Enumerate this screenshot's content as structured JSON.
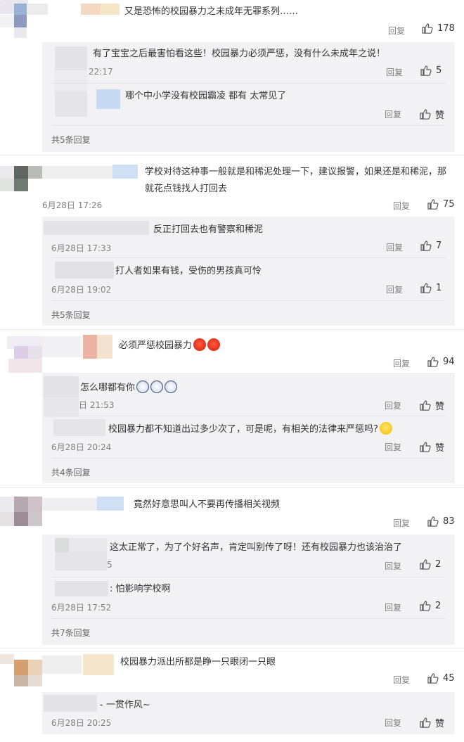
{
  "ui": {
    "reply_label": "回复",
    "like_label_zan": "赞"
  },
  "threads": [
    {
      "text": "又是恐怖的校园暴力之未成年无罪系列……",
      "likes": "178",
      "replies": [
        {
          "text": "有了宝宝之后最害怕看这些！校园暴力必须严惩，没有什么未成年之说！",
          "time": "22:17",
          "likes": "5"
        },
        {
          "text": "哪个中小学没有校园霸凌 都有 太常见了",
          "time": "",
          "likes": "赞"
        }
      ],
      "more": "共5条回复"
    },
    {
      "text": "学校对待这种事一般就是和稀泥处理一下，建议报警，如果还是和稀泥，那就花点钱找人打回去",
      "time": "6月28日 17:26",
      "likes": "75",
      "replies": [
        {
          "text": "反正打回去也有警察和稀泥",
          "time": "6月28日 17:33",
          "likes": "7"
        },
        {
          "text": "打人者如果有钱，受伤的男孩真可怜",
          "time": "6月28日 19:02",
          "likes": "1"
        }
      ],
      "more": "共5条回复"
    },
    {
      "text": "必须严惩校园暴力",
      "likes": "94",
      "replies": [
        {
          "text": "怎么哪都有你",
          "time": "日 21:53",
          "likes": "赞"
        },
        {
          "text": "校园暴力都不知道出过多少次了，可是呢，有相关的法律来严惩吗?",
          "time": "6月28日 20:24",
          "likes": "赞"
        }
      ],
      "more": "共4条回复"
    },
    {
      "text": "竟然好意思叫人不要再传播相关视频",
      "likes": "83",
      "replies": [
        {
          "text": "这太正常了，为了个好名声，肯定叫别传了呀！还有校园暴力也该治治了",
          "time": "5",
          "likes": "2"
        },
        {
          "text": "怕影响学校啊",
          "time": "6月28日 17:52",
          "likes": "2"
        }
      ],
      "more": "共7条回复"
    },
    {
      "text": "校园暴力派出所都是睁一只眼闭一只眼",
      "likes": "45",
      "replies": [
        {
          "text": "一贯作风~",
          "time": "6月28日 20:25",
          "likes": "赞"
        }
      ]
    }
  ]
}
